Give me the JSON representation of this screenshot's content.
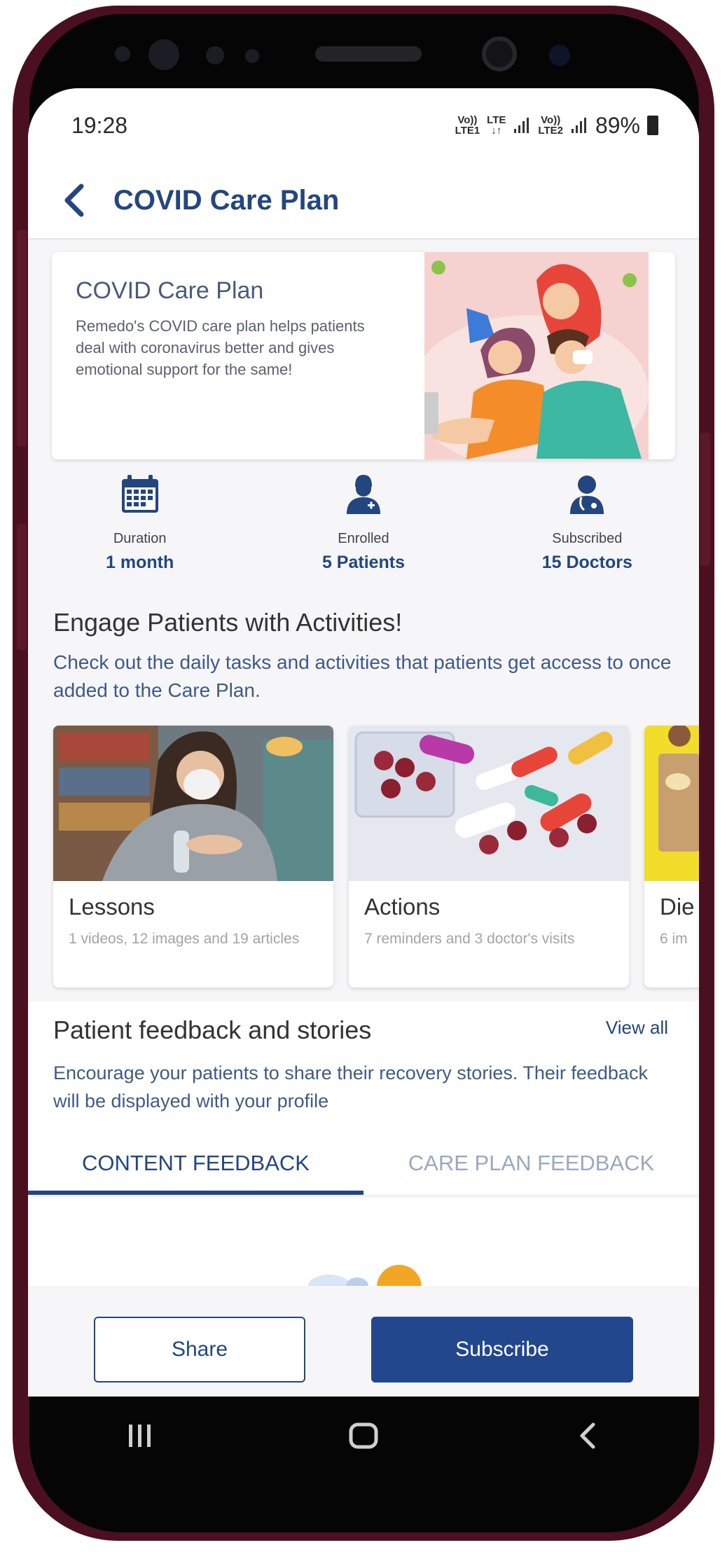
{
  "status_bar": {
    "time": "19:28",
    "sim1_top": "Vo))",
    "sim1_bottom": "LTE1",
    "lte_top": "LTE",
    "lte_bottom": "↓↑",
    "sim2_top": "Vo))",
    "sim2_bottom": "LTE2",
    "battery": "89%"
  },
  "header": {
    "title": "COVID Care Plan"
  },
  "hero": {
    "title": "COVID Care Plan",
    "description": "Remedo's COVID care plan helps patients deal with coronavirus better and gives emotional support for the same!"
  },
  "stats": [
    {
      "label": "Duration",
      "value": "1 month",
      "icon": "calendar-icon"
    },
    {
      "label": "Enrolled",
      "value": "5 Patients",
      "icon": "patient-icon"
    },
    {
      "label": "Subscribed",
      "value": "15 Doctors",
      "icon": "doctor-icon"
    }
  ],
  "activities": {
    "title": "Engage Patients with Activities!",
    "description": "Check out the daily tasks and activities that patients get access to once added to the Care Plan.",
    "cards": [
      {
        "title": "Lessons",
        "subtitle": "1 videos, 12 images and 19 articles"
      },
      {
        "title": "Actions",
        "subtitle": "7 reminders and 3 doctor's visits"
      },
      {
        "title": "Die",
        "subtitle": "6 im"
      }
    ]
  },
  "feedback": {
    "title": "Patient feedback and stories",
    "view_all": "View all",
    "description": "Encourage your patients to share their recovery stories. Their feedback will be displayed with your profile",
    "tabs": [
      {
        "label": "CONTENT FEEDBACK",
        "active": true
      },
      {
        "label": "CARE PLAN FEEDBACK",
        "active": false
      }
    ]
  },
  "actions": {
    "share": "Share",
    "subscribe": "Subscribe"
  },
  "colors": {
    "primary": "#23467f",
    "button": "#23478c",
    "frame": "#4a1020"
  }
}
